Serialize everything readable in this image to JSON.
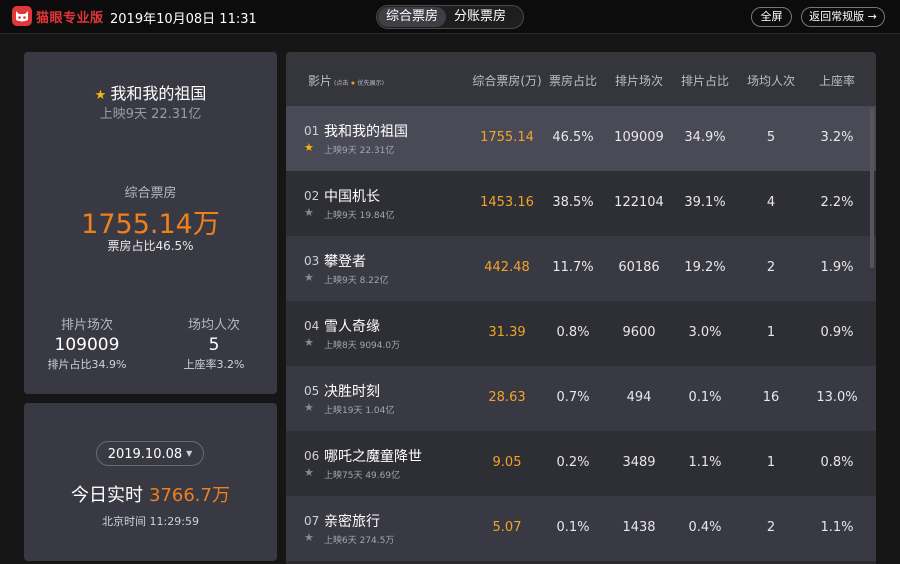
{
  "header": {
    "logo_text": "猫眼专业版",
    "datetime": "2019年10月08日 11:31",
    "tabs": [
      {
        "label": "综合票房",
        "active": true
      },
      {
        "label": "分账票房",
        "active": false
      }
    ],
    "fullscreen_label": "全屏",
    "back_label": "返回常规版 →"
  },
  "summary": {
    "movie_title": "我和我的祖国",
    "movie_sub": "上映9天 22.31亿",
    "box_office_label": "综合票房",
    "box_office_value": "1755.14万",
    "box_office_ratio": "票房占比46.5%",
    "shows_label": "排片场次",
    "shows_value": "109009",
    "shows_sub": "排片占比34.9%",
    "avg_label": "场均人次",
    "avg_value": "5",
    "avg_sub": "上座率3.2%"
  },
  "today": {
    "date": "2019.10.08",
    "realtime_label": "今日实时",
    "realtime_value": "3766.7万",
    "beijing_time": "北京时间 11:29:59"
  },
  "table": {
    "headers": {
      "film": "影片",
      "film_hint_pre": "(点击",
      "film_hint_post": "优先展示)",
      "box_office": "综合票房(万)",
      "bo_ratio": "票房占比",
      "shows": "排片场次",
      "show_ratio": "排片占比",
      "avg": "场均人次",
      "occupancy": "上座率"
    },
    "rows": [
      {
        "rank": "01",
        "name": "我和我的祖国",
        "sub": "上映9天  22.31亿",
        "starred": true,
        "box_office": "1755.14",
        "bo_ratio": "46.5%",
        "shows": "109009",
        "show_ratio": "34.9%",
        "avg": "5",
        "occupancy": "3.2%"
      },
      {
        "rank": "02",
        "name": "中国机长",
        "sub": "上映9天  19.84亿",
        "starred": false,
        "box_office": "1453.16",
        "bo_ratio": "38.5%",
        "shows": "122104",
        "show_ratio": "39.1%",
        "avg": "4",
        "occupancy": "2.2%"
      },
      {
        "rank": "03",
        "name": "攀登者",
        "sub": "上映9天  8.22亿",
        "starred": false,
        "box_office": "442.48",
        "bo_ratio": "11.7%",
        "shows": "60186",
        "show_ratio": "19.2%",
        "avg": "2",
        "occupancy": "1.9%"
      },
      {
        "rank": "04",
        "name": "雪人奇缘",
        "sub": "上映8天  9094.0万",
        "starred": false,
        "box_office": "31.39",
        "bo_ratio": "0.8%",
        "shows": "9600",
        "show_ratio": "3.0%",
        "avg": "1",
        "occupancy": "0.9%"
      },
      {
        "rank": "05",
        "name": "决胜时刻",
        "sub": "上映19天  1.04亿",
        "starred": false,
        "box_office": "28.63",
        "bo_ratio": "0.7%",
        "shows": "494",
        "show_ratio": "0.1%",
        "avg": "16",
        "occupancy": "13.0%"
      },
      {
        "rank": "06",
        "name": "哪吒之魔童降世",
        "sub": "上映75天  49.69亿",
        "starred": false,
        "box_office": "9.05",
        "bo_ratio": "0.2%",
        "shows": "3489",
        "show_ratio": "1.1%",
        "avg": "1",
        "occupancy": "0.8%"
      },
      {
        "rank": "07",
        "name": "亲密旅行",
        "sub": "上映6天  274.5万",
        "starred": false,
        "box_office": "5.07",
        "bo_ratio": "0.1%",
        "shows": "1438",
        "show_ratio": "0.4%",
        "avg": "2",
        "occupancy": "1.1%"
      }
    ]
  },
  "colors": {
    "brand": "#e0363a",
    "accent_orange": "#f0801e",
    "star": "#f5b70a",
    "panel": "#393943"
  }
}
